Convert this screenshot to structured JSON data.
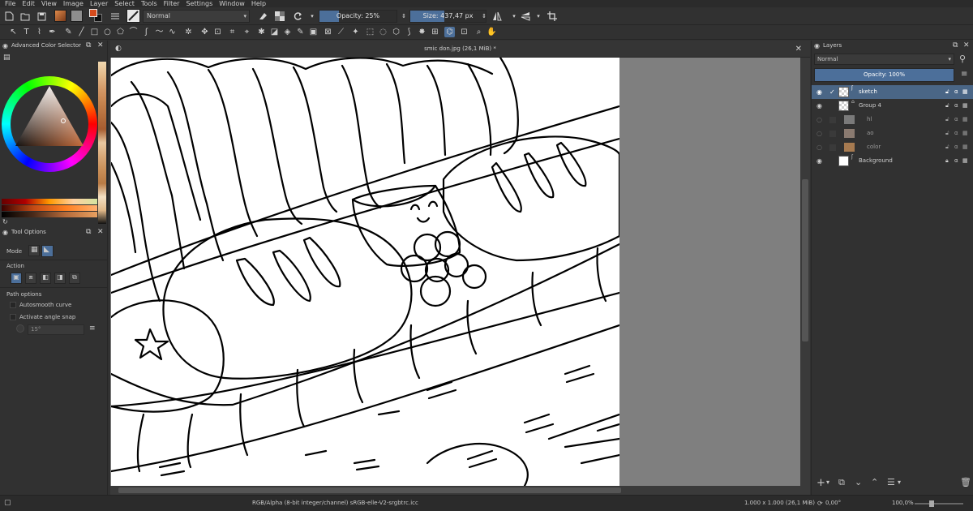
{
  "menu": [
    "File",
    "Edit",
    "View",
    "Image",
    "Layer",
    "Select",
    "Tools",
    "Filter",
    "Settings",
    "Window",
    "Help"
  ],
  "toolbar": {
    "blend_mode": "Normal",
    "opacity_label": "Opacity: 25%",
    "opacity_value": 0.25,
    "size_label": "Size: 437,47 px",
    "size_fill": 0.45,
    "foreground_color": "#d64b1c",
    "background_color": "#111111",
    "accent": "#4c6f9a"
  },
  "left_docker": {
    "color_selector_title": "Advanced Color Selector",
    "tool_options_title": "Tool Options",
    "mode_label": "Mode",
    "action_label": "Action",
    "path_options_label": "Path options",
    "autosmooth_label": "Autosmooth curve",
    "angle_snap_label": "Activate angle snap",
    "angle_value": "15°"
  },
  "document": {
    "tab_title": "smic don.jpg (26,1 MiB) *"
  },
  "layers": {
    "title": "Layers",
    "blend_mode": "Normal",
    "opacity_label": "Opacity:  100%",
    "items": [
      {
        "name": "sketch",
        "visible": true,
        "selected": true
      },
      {
        "name": "Group 4",
        "visible": true,
        "selected": false
      },
      {
        "name": "hl",
        "visible": false,
        "selected": false
      },
      {
        "name": "ao",
        "visible": false,
        "selected": false
      },
      {
        "name": "color",
        "visible": false,
        "selected": false
      },
      {
        "name": "Background",
        "visible": true,
        "selected": false
      }
    ]
  },
  "status": {
    "color_space": "RGB/Alpha (8-bit integer/channel)  sRGB-elle-V2-srgbtrc.icc",
    "image_size": "1.000 x 1.000 (26,1 MiB)",
    "rotation": "0,00°",
    "zoom": "100,0%"
  }
}
